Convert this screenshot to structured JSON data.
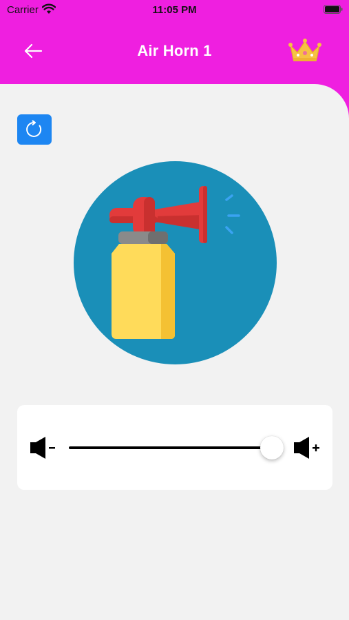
{
  "status_bar": {
    "carrier": "Carrier",
    "time": "11:05 PM",
    "wifi_icon": "wifi-icon",
    "battery_icon": "battery-icon"
  },
  "nav": {
    "title": "Air Horn 1",
    "back_icon": "arrow-left-icon",
    "premium_icon": "crown-icon"
  },
  "content": {
    "replay_icon": "refresh-icon",
    "sound_image": "air-horn-icon"
  },
  "volume": {
    "min_icon": "volume-down-icon",
    "max_icon": "volume-up-icon",
    "level": 0.95
  },
  "colors": {
    "header": "#ef1fe0",
    "background": "#f2f2f2",
    "accent": "#1d86f2",
    "horn_circle": "#1a8fb8"
  }
}
